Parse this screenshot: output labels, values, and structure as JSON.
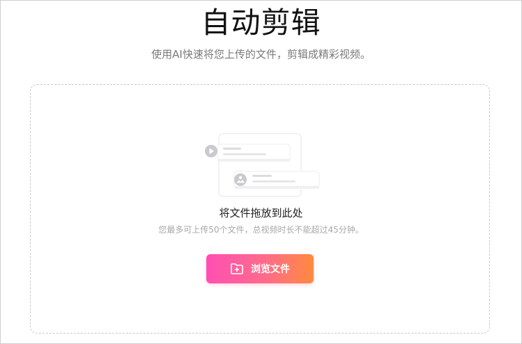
{
  "header": {
    "title": "自动剪辑",
    "subtitle": "使用AI快速将您上传的文件，剪辑成精彩视频。"
  },
  "dropzone": {
    "title": "将文件拖放到此处",
    "hint": "您最多可上传50个文件，总视频时长不能超过45分钟。",
    "browse_label": "浏览文件"
  },
  "icons": {
    "illustration": "upload-illustration",
    "video": "play-circle-icon",
    "image": "image-circle-icon",
    "browse": "folder-plus-icon"
  },
  "colors": {
    "button_gradient_start": "#ff4fb3",
    "button_gradient_end": "#ff8a3d",
    "subtitle": "#7a7a7a",
    "hint": "#a8a8a8"
  }
}
